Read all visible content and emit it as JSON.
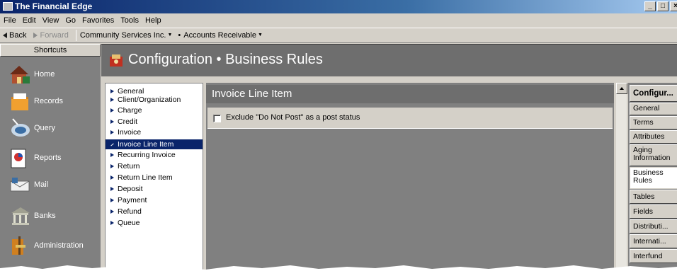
{
  "window": {
    "title": "The Financial Edge",
    "controls": [
      "_",
      "□",
      "×"
    ]
  },
  "menu": [
    "File",
    "Edit",
    "View",
    "Go",
    "Favorites",
    "Tools",
    "Help"
  ],
  "toolbar": {
    "back": "Back",
    "forward": "Forward",
    "org": "Community Services Inc.",
    "module": "Accounts Receivable"
  },
  "shortcuts": {
    "title": "Shortcuts",
    "items": [
      {
        "label": "Home",
        "icon": "home-icon"
      },
      {
        "label": "Records",
        "icon": "records-icon"
      },
      {
        "label": "Query",
        "icon": "query-icon"
      },
      {
        "label": "Reports",
        "icon": "reports-icon"
      },
      {
        "label": "Mail",
        "icon": "mail-icon"
      },
      {
        "label": "Banks",
        "icon": "banks-icon"
      },
      {
        "label": "Administration",
        "icon": "administration-icon"
      }
    ]
  },
  "header": {
    "title": "Configuration • Business Rules"
  },
  "tree": {
    "items": [
      "General",
      "Client/Organization",
      "Charge",
      "Credit",
      "Invoice",
      "Invoice Line Item",
      "Recurring Invoice",
      "Return",
      "Return Line Item",
      "Deposit",
      "Payment",
      "Refund",
      "Queue"
    ],
    "selected_index": 5
  },
  "content": {
    "title": "Invoice Line Item",
    "option_label": "Exclude \"Do Not Post\" as a post status",
    "option_checked": false
  },
  "right_tabs": {
    "header": "Configur...",
    "items": [
      "General",
      "Terms",
      "Attributes",
      "Aging Information",
      "Business Rules",
      "Tables",
      "Fields",
      "Distributi...",
      "Internati...",
      "Interfund"
    ],
    "active": "Business Rules"
  },
  "colors": {
    "title_bar": "#0a246a",
    "selection": "#0a246a",
    "panel_gray": "#808080",
    "header_gray": "#6e6e6e"
  }
}
